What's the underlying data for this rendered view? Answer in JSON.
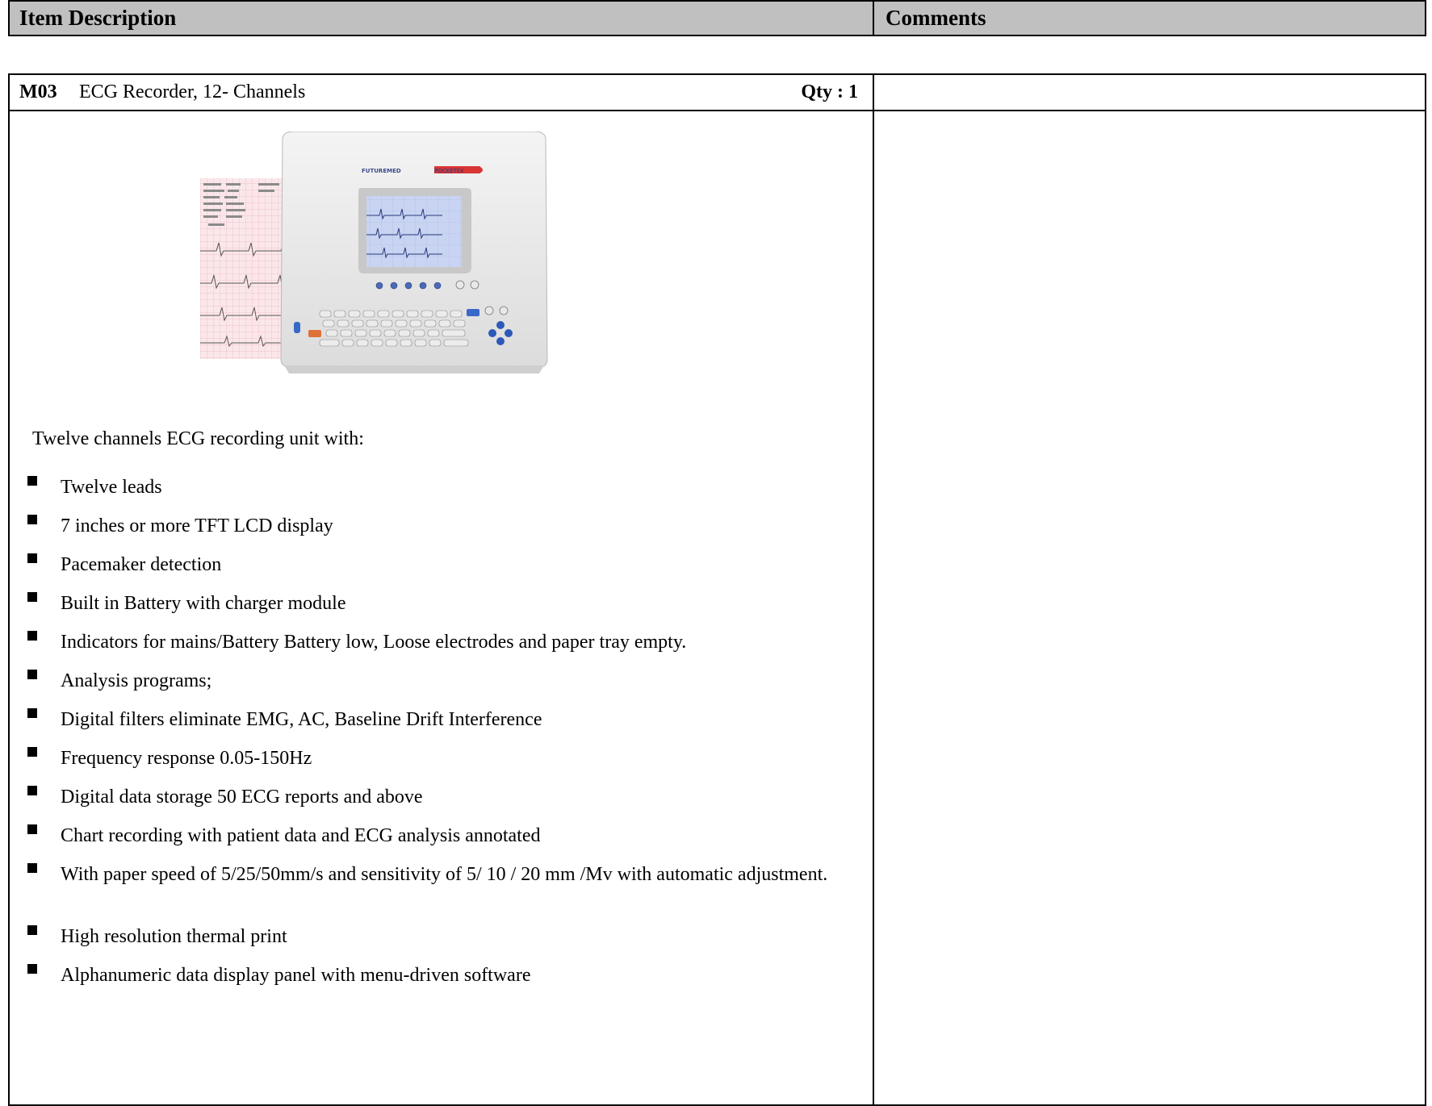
{
  "header": {
    "col1": "Item Description",
    "col2": "Comments"
  },
  "item": {
    "code": "M03",
    "name": "ECG Recorder, 12- Channels",
    "qty_label": "Qty : 1",
    "intro": "Twelve channels ECG recording unit with:",
    "features": [
      "Twelve leads",
      "7 inches or more TFT LCD display",
      "Pacemaker detection",
      "Built in Battery with charger module",
      "Indicators for mains/Battery Battery low, Loose electrodes and paper tray empty.",
      "Analysis programs;",
      "Digital filters eliminate EMG, AC, Baseline Drift Interference",
      "Frequency response 0.05-150Hz",
      "Digital data storage 50 ECG reports and above",
      "Chart recording with patient data and ECG analysis annotated",
      "With paper speed of 5/25/50mm/s and sensitivity of 5/ 10 / 20 mm /Mv with automatic adjustment.",
      "High resolution thermal print",
      "Alphanumeric data display panel with menu-driven software"
    ]
  },
  "device_image": {
    "brand_text": "FUTUREMED",
    "model_text": "POCKETEK"
  }
}
